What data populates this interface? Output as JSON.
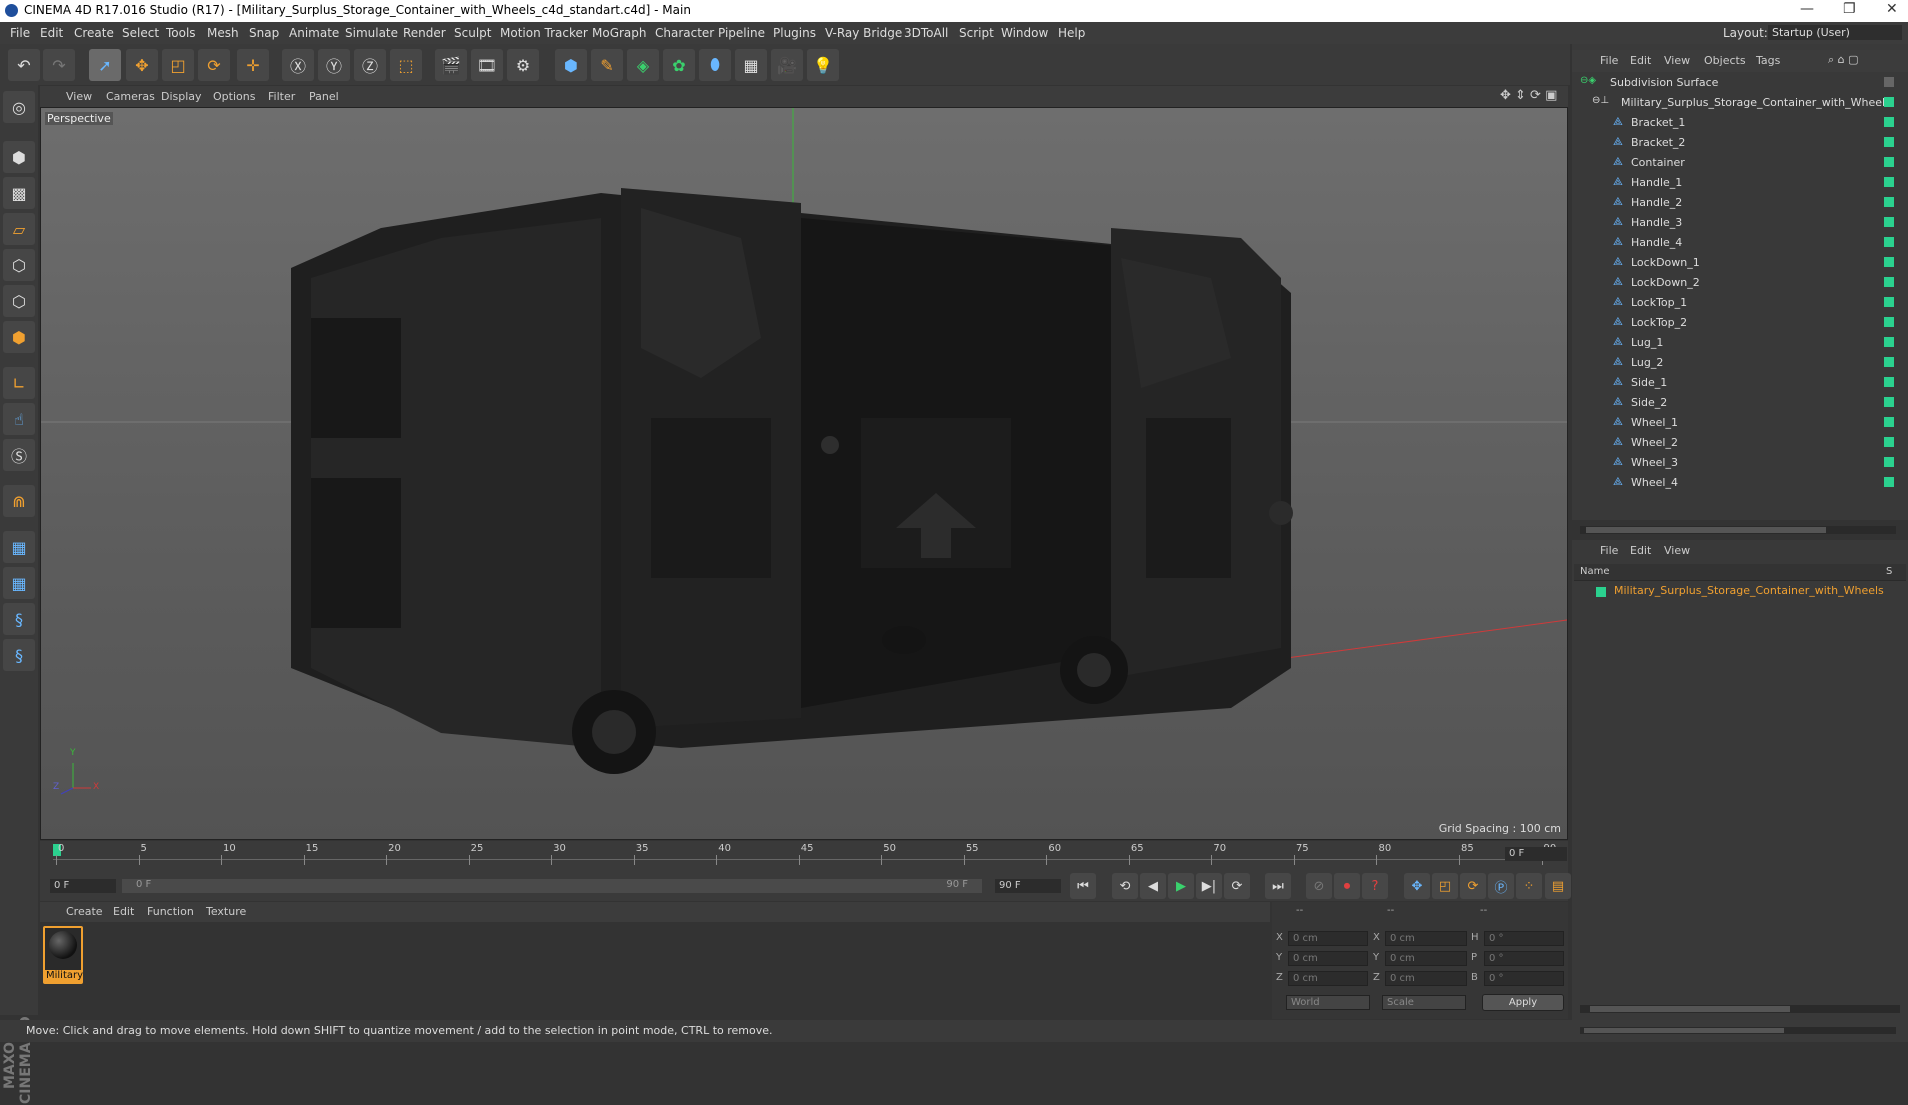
{
  "window": {
    "title": "CINEMA 4D R17.016 Studio (R17) - [Military_Surplus_Storage_Container_with_Wheels_c4d_standart.c4d] - Main",
    "minimize": "—",
    "maximize": "❐",
    "close": "✕"
  },
  "menubar": {
    "items": [
      "File",
      "Edit",
      "Create",
      "Select",
      "Tools",
      "Mesh",
      "Snap",
      "Animate",
      "Simulate",
      "Render",
      "Sculpt",
      "Motion Tracker",
      "MoGraph",
      "Character",
      "Pipeline",
      "Plugins",
      "V-Ray Bridge",
      "3DToAll",
      "Script",
      "Window",
      "Help"
    ],
    "layout_label": "Layout:",
    "layout_value": "Startup (User)"
  },
  "viewport": {
    "menu": [
      "View",
      "Cameras",
      "Display",
      "Options",
      "Filter",
      "Panel"
    ],
    "label": "Perspective",
    "grid_spacing": "Grid Spacing : 100 cm",
    "axis_y": "Y",
    "axis_x": "X",
    "axis_z": "Z"
  },
  "object_manager": {
    "menu": [
      "File",
      "Edit",
      "View",
      "Objects",
      "Tags"
    ],
    "root": "Subdivision Surface",
    "group": "Military_Surplus_Storage_Container_with_Wheels",
    "children": [
      "Bracket_1",
      "Bracket_2",
      "Container",
      "Handle_1",
      "Handle_2",
      "Handle_3",
      "Handle_4",
      "LockDown_1",
      "LockDown_2",
      "LockTop_1",
      "LockTop_2",
      "Lug_1",
      "Lug_2",
      "Side_1",
      "Side_2",
      "Wheel_1",
      "Wheel_2",
      "Wheel_3",
      "Wheel_4"
    ]
  },
  "attribute_manager": {
    "menu": [
      "File",
      "Edit",
      "View"
    ],
    "col_name": "Name",
    "col_s": "S",
    "item": "Military_Surplus_Storage_Container_with_Wheels"
  },
  "timeline": {
    "ticks": [
      "0",
      "5",
      "10",
      "15",
      "20",
      "25",
      "30",
      "35",
      "40",
      "45",
      "50",
      "55",
      "60",
      "65",
      "70",
      "75",
      "80",
      "85",
      "90"
    ],
    "current_frame": "0 F",
    "start_frame": "0 F",
    "range_start": "0 F",
    "range_end": "90 F",
    "end_frame": "90 F"
  },
  "material_manager": {
    "menu": [
      "Create",
      "Edit",
      "Function",
      "Texture"
    ],
    "material_name": "Military"
  },
  "coordinates": {
    "headers": [
      "--",
      "--",
      "--"
    ],
    "rows": [
      {
        "l1": "X",
        "v1": "0 cm",
        "l2": "X",
        "v2": "0 cm",
        "l3": "H",
        "v3": "0 °"
      },
      {
        "l1": "Y",
        "v1": "0 cm",
        "l2": "Y",
        "v2": "0 cm",
        "l3": "P",
        "v3": "0 °"
      },
      {
        "l1": "Z",
        "v1": "0 cm",
        "l2": "Z",
        "v2": "0 cm",
        "l3": "B",
        "v3": "0 °"
      }
    ],
    "mode1": "World",
    "mode2": "Scale",
    "apply": "Apply"
  },
  "status": "Move: Click and drag to move elements. Hold down SHIFT to quantize movement / add to the selection in point mode, CTRL to remove.",
  "brand": "MAXON CINEMA 4D",
  "colors": {
    "accent_orange": "#f0a030",
    "visible_green": "#2bd18f",
    "axis_red": "#d03a3a",
    "axis_green": "#3ab83a"
  }
}
